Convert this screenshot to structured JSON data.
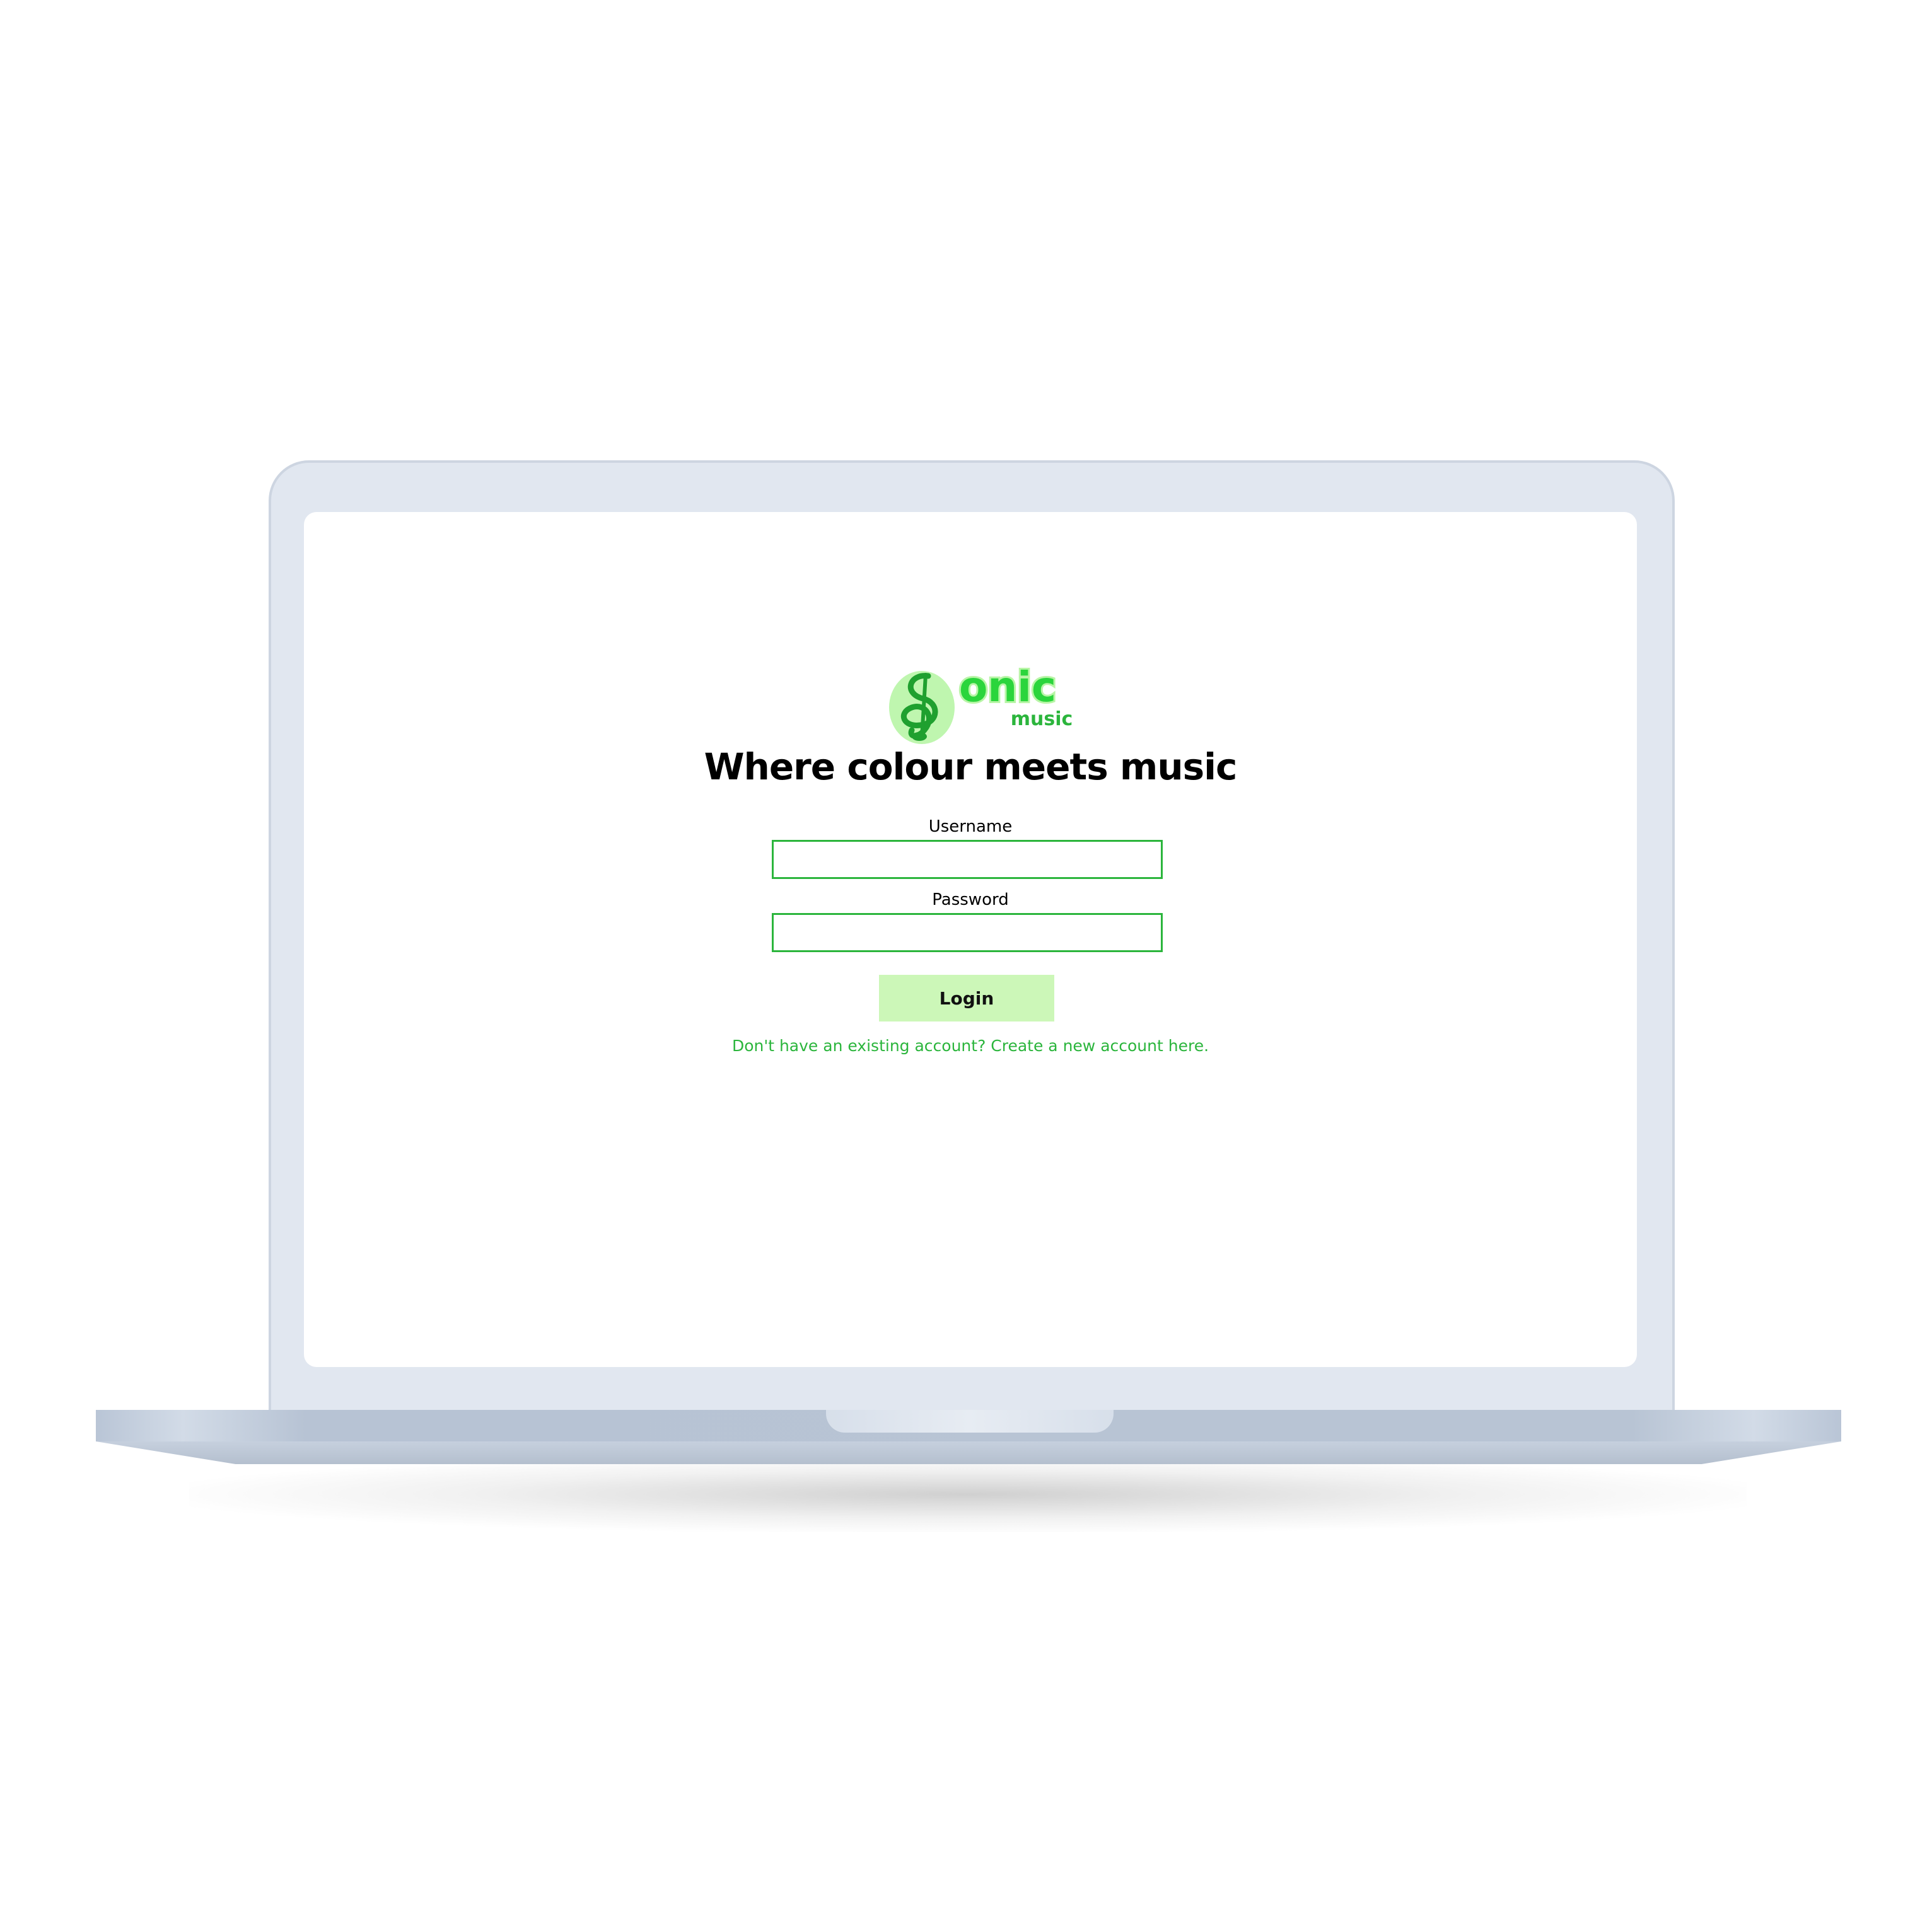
{
  "brand": {
    "logo_text": "onic",
    "logo_subtext": "music",
    "logo_icon": "treble-clef-icon",
    "primary_color": "#2bb53c",
    "light_color": "#ccf7b8"
  },
  "login": {
    "tagline": "Where colour meets music",
    "username_label": "Username",
    "username_value": "",
    "password_label": "Password",
    "password_value": "",
    "submit_label": "Login",
    "signup_link": "Don't have an existing account? Create a new account here."
  }
}
